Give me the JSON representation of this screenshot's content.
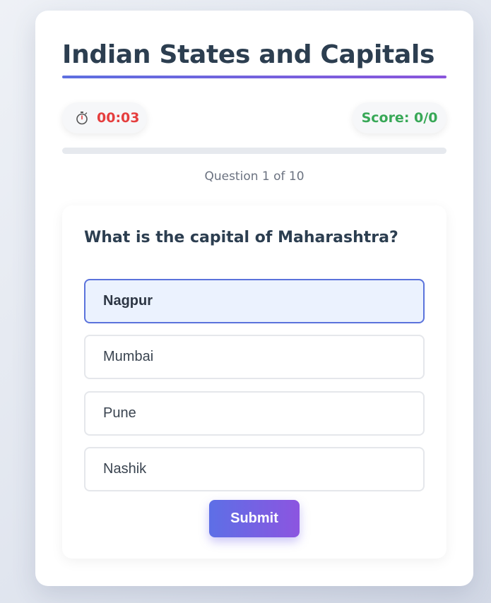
{
  "quiz": {
    "title": "Indian States and Capitals",
    "timer": {
      "icon": "stopwatch-icon",
      "value": "00:03"
    },
    "score": "Score: 0/0",
    "progress": {
      "fraction": 0.0
    },
    "counter": "Question 1 of 10",
    "question": "What is the capital of Maharashtra?",
    "options": [
      {
        "label": "Nagpur",
        "selected": true
      },
      {
        "label": "Mumbai",
        "selected": false
      },
      {
        "label": "Pune",
        "selected": false
      },
      {
        "label": "Nashik",
        "selected": false
      }
    ],
    "submit_label": "Submit"
  },
  "colors": {
    "accent_start": "#5d6fe0",
    "accent_end": "#8a55dc",
    "timer": "#e53e3e",
    "score": "#38a857",
    "selected_bg": "#ebf2fe",
    "selected_border": "#5b73dc"
  }
}
